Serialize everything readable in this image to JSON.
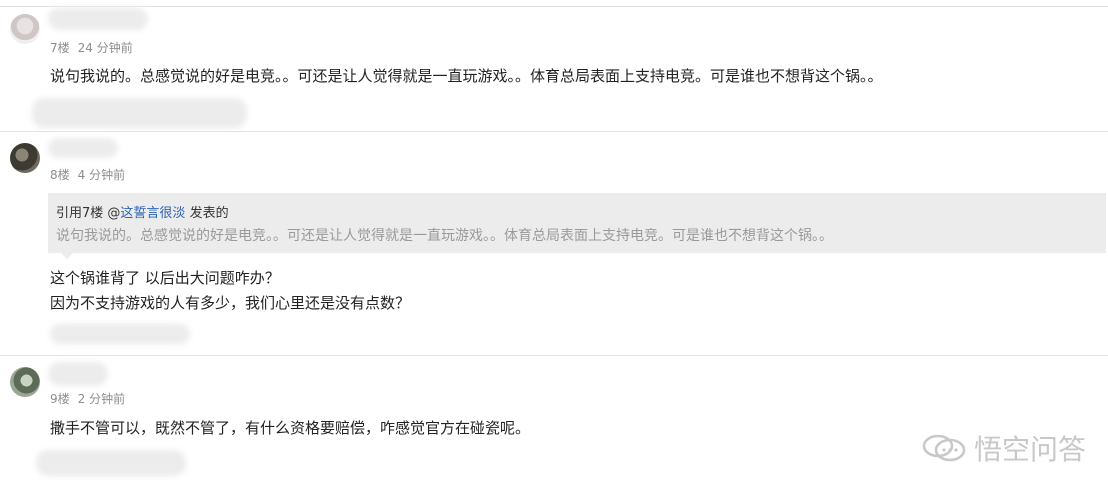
{
  "comments": [
    {
      "floor": "7楼",
      "time": "24 分钟前",
      "text": "说句我说的。总感觉说的好是电竞。。可还是让人觉得就是一直玩游戏。。体育总局表面上支持电竞。可是谁也不想背这个锅。。"
    },
    {
      "floor": "8楼",
      "time": "4 分钟前",
      "quote": {
        "prefix": "引用7楼",
        "at": "@",
        "user": "这誓言很淡",
        "suffix": "发表的",
        "text": "说句我说的。总感觉说的好是电竞。。可还是让人觉得就是一直玩游戏。。体育总局表面上支持电竞。可是谁也不想背这个锅。。"
      },
      "lines": [
        "这个锅谁背了 以后出大问题咋办？",
        "因为不支持游戏的人有多少，我们心里还是没有点数？"
      ]
    },
    {
      "floor": "9楼",
      "time": "2 分钟前",
      "text": "撒手不管可以，既然不管了，有什么资格要赔偿，咋感觉官方在碰瓷呢。"
    }
  ],
  "watermark": {
    "icon": "speech-bubbles-icon",
    "text": "悟空问答"
  }
}
